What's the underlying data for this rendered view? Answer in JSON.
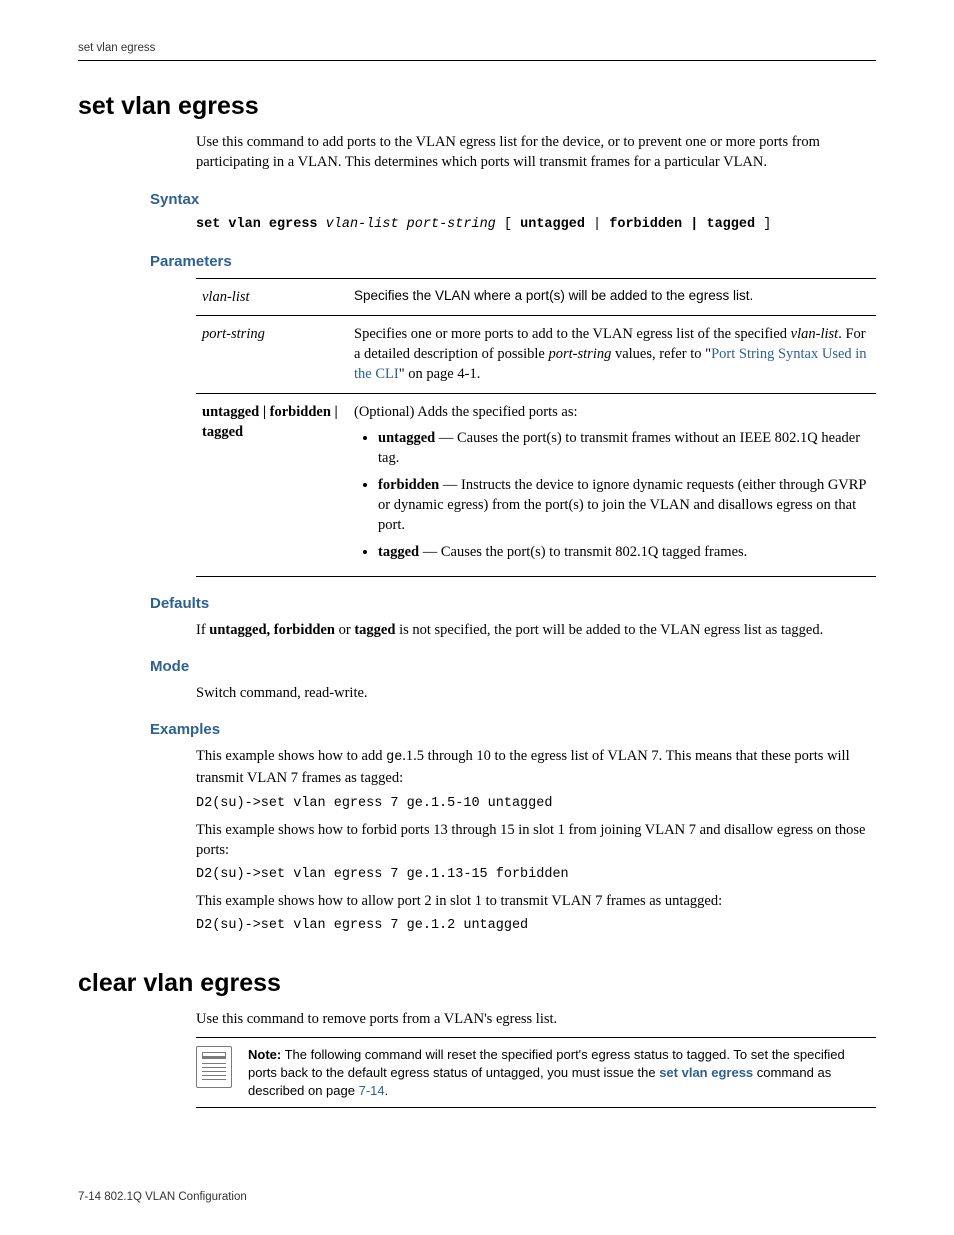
{
  "running_head": "set vlan egress",
  "footer": "7-14   802.1Q VLAN Configuration",
  "section1": {
    "title": "set vlan egress",
    "intro": "Use this command to add ports to the VLAN egress list for the device, or to prevent one or more ports from participating in a VLAN. This determines which ports will transmit frames for a particular VLAN.",
    "syntax_heading": "Syntax",
    "syntax": {
      "cmd": "set vlan egress",
      "arg1": "vlan-list",
      "arg2": "port-string",
      "opt_open": " [",
      "kw1": "untagged",
      "pipe": " | ",
      "kw2": "forbidden | tagged",
      "opt_close": "]"
    },
    "parameters_heading": "Parameters",
    "params": {
      "row1": {
        "name": "vlan-list",
        "desc_prefix": "Specifies the VLAN where a port(s) will be added to the egress list."
      },
      "row2": {
        "name": "port-string",
        "d1": "Specifies one or more ports to add to the VLAN egress list of the specified ",
        "i1": "vlan-list",
        "d2": ". For a detailed description of possible ",
        "i2": "port-string",
        "d3": " values, refer to \"",
        "link": "Port String Syntax Used in the CLI",
        "d4": "\" on page 4-1."
      },
      "row3": {
        "name": "untagged | forbidden | tagged",
        "lead": "(Optional) Adds the specified ports as:",
        "b1_k": "untagged",
        "b1_v": " — Causes the port(s) to transmit frames without an IEEE 802.1Q header tag.",
        "b2_k": "forbidden",
        "b2_v": " — Instructs the device to ignore dynamic requests (either through GVRP or dynamic egress) from the port(s) to join the VLAN and disallows egress on that port.",
        "b3_k": "tagged",
        "b3_v": " — Causes the port(s) to transmit 802.1Q tagged frames."
      }
    },
    "defaults_heading": "Defaults",
    "defaults": {
      "pre": "If ",
      "b1": "untagged, forbidden",
      "mid": " or ",
      "b2": "tagged",
      "post": " is not specified, the port will be added to the VLAN egress list as tagged."
    },
    "mode_heading": "Mode",
    "mode_text": "Switch command, read-write.",
    "examples_heading": "Examples",
    "ex1_pre": "This example shows how to add ",
    "ex1_code": "ge",
    "ex1_post": ".1.5 through 10 to the egress list of VLAN 7. This means that these ports will transmit VLAN 7 frames as tagged:",
    "ex1_cmd": "D2(su)->set vlan egress 7 ge.1.5-10 untagged",
    "ex2_text": "This example shows how to forbid ports 13 through 15 in slot 1 from joining VLAN 7 and disallow egress on those ports:",
    "ex2_cmd": "D2(su)->set vlan egress 7 ge.1.13-15 forbidden",
    "ex3_text": "This example shows how to allow port 2 in slot 1 to transmit VLAN 7 frames as untagged:",
    "ex3_cmd": "D2(su)->set vlan egress 7 ge.1.2 untagged"
  },
  "section2": {
    "title": "clear vlan egress",
    "intro": "Use this command to remove ports from a VLAN's egress list.",
    "note_label": "Note:",
    "note_pre": " The following command will reset the specified port's egress status to tagged. To set the specified ports back to the default egress status of untagged, you must issue the ",
    "note_link": "set vlan egress",
    "note_post": " command as described on page ",
    "note_page": "7-14",
    "note_end": "."
  }
}
